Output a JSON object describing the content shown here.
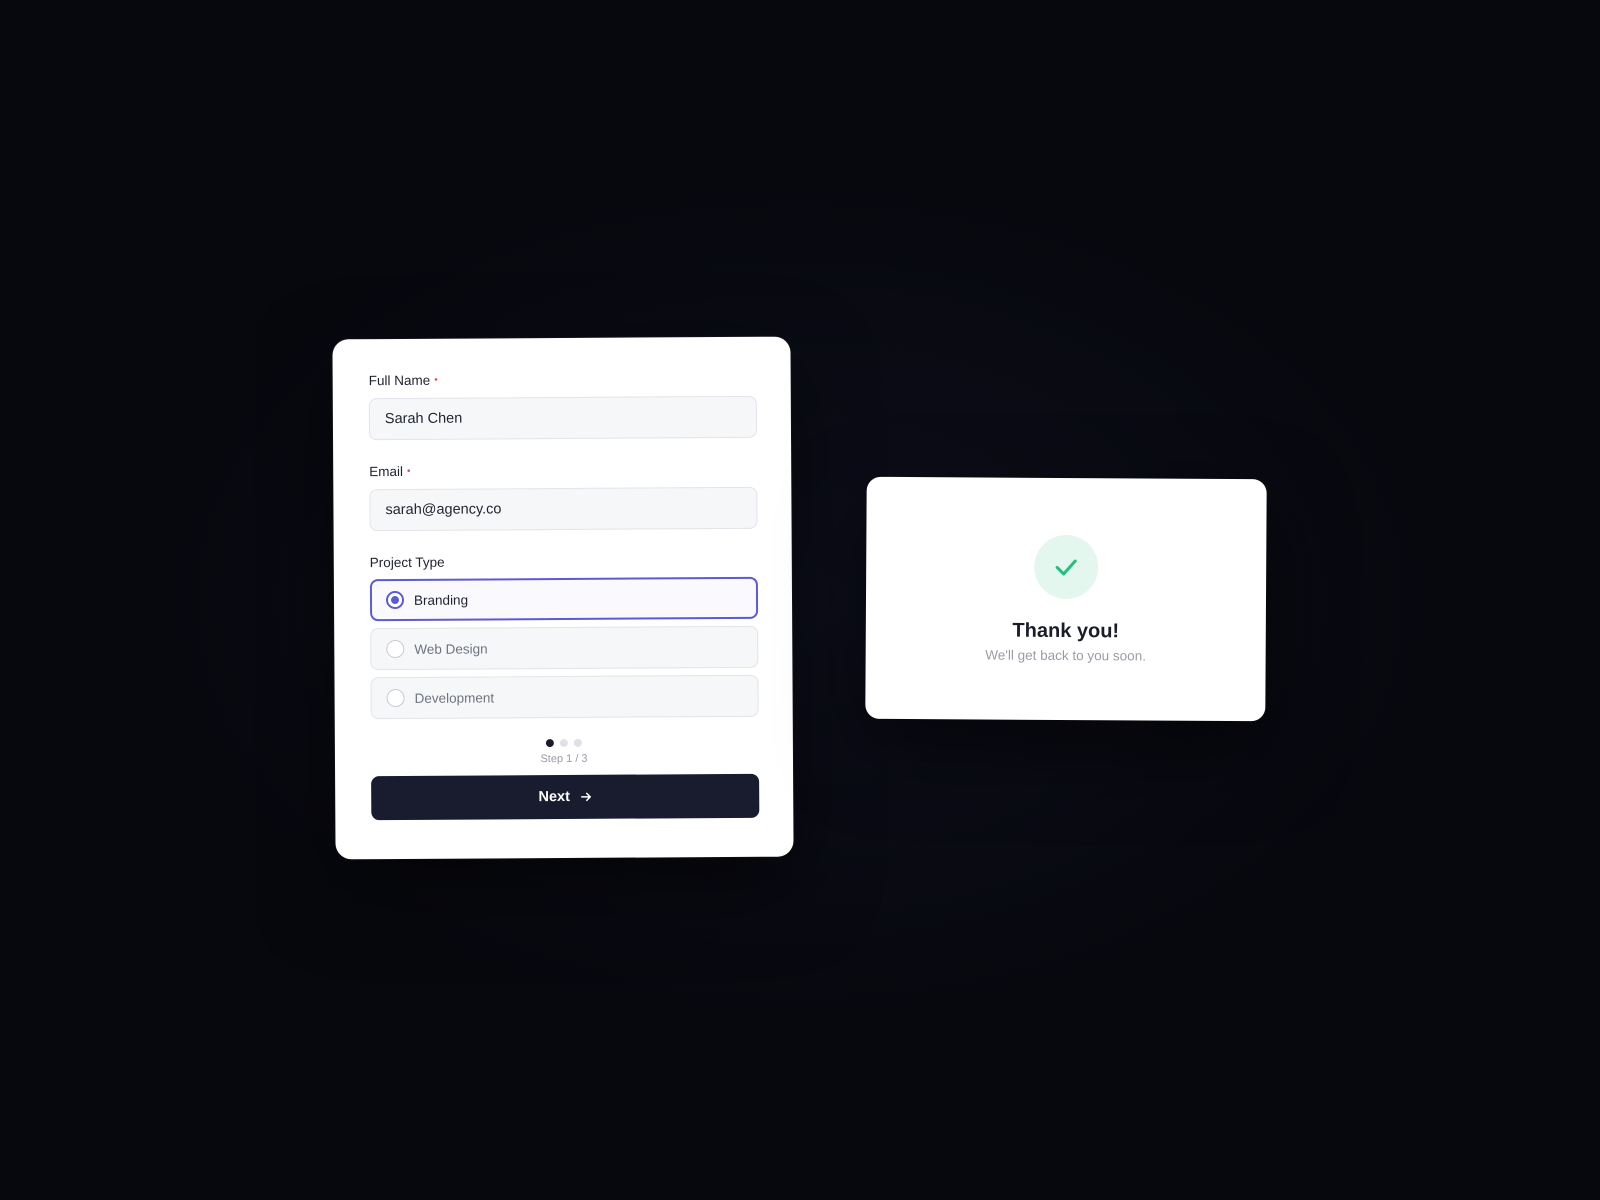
{
  "form": {
    "full_name": {
      "label": "Full Name",
      "required_marker": "•",
      "value": "Sarah Chen"
    },
    "email": {
      "label": "Email",
      "required_marker": "•",
      "value": "sarah@agency.co"
    },
    "project_type": {
      "label": "Project Type",
      "options": [
        {
          "label": "Branding",
          "selected": true
        },
        {
          "label": "Web Design",
          "selected": false
        },
        {
          "label": "Development",
          "selected": false
        }
      ]
    },
    "progress": {
      "current_step": 1,
      "total_steps": 3,
      "text": "Step 1 / 3"
    },
    "next_button": {
      "label": "Next",
      "icon": "arrow-right-icon"
    }
  },
  "confirmation": {
    "icon": "checkmark-icon",
    "title": "Thank you!",
    "subtitle": "We'll get back to you soon."
  },
  "colors": {
    "background": "#0a0b14",
    "accent": "#5b5bd6",
    "button": "#191b2e",
    "success": "#22c07a",
    "success_bg": "#e3f7ee",
    "required": "#e5484d"
  }
}
